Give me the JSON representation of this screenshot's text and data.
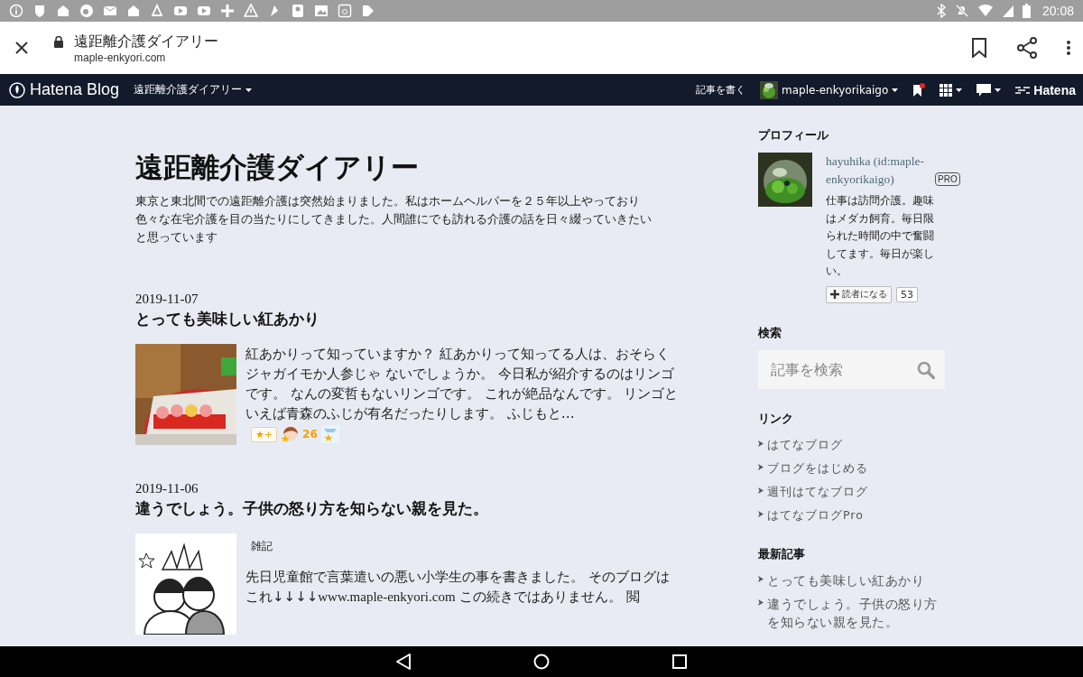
{
  "status_bar": {
    "time": "20:08"
  },
  "browser": {
    "title": "遠距離介護ダイアリー",
    "url": "maple-enkyori.com"
  },
  "hatena_bar": {
    "logo": "Hatena Blog",
    "blog_menu": "遠距離介護ダイアリー",
    "write": "記事を書く",
    "user": "maple-enkyorikaigo",
    "brand": "Hatena"
  },
  "blog": {
    "title": "遠距離介護ダイアリー",
    "description": "東京と東北間での遠距離介護は突然始まりました。私はホームヘルパーを２５年以上やっており色々な在宅介護を目の当たりにしてきました。人間誰にでも訪れる介護の話を日々綴っていきたいと思っています"
  },
  "posts": [
    {
      "date": "2019-11-07",
      "title": "とっても美味しい紅あかり",
      "excerpt": "紅あかりって知っていますか？ 紅あかりって知ってる人は、おそらくジャガイモか人参じゃ ないでしょうか。 今日私が紹介するのはリンゴです。 なんの変哲もないリンゴです。 これが絶品なんです。 リンゴといえば青森のふじが有名だったりします。 ふじもと…",
      "stars": {
        "add": "★+",
        "count": "26"
      }
    },
    {
      "date": "2019-11-06",
      "title": "違うでしょう。子供の怒り方を知らない親を見た。",
      "category": "雑記",
      "excerpt": "先日児童館で言葉遣いの悪い小学生の事を書きました。 そのブログはこれ↓↓↓↓",
      "link": "www.maple-enkyori.com",
      "excerpt_after": " この続きではありません。 閲"
    }
  ],
  "sidebar": {
    "profile": {
      "heading": "プロフィール",
      "name": "hayuhika (id:maple-enkyorikaigo)",
      "badge": "PRO",
      "bio": "仕事は訪問介護。趣味はメダカ飼育。毎日限られた時間の中で奮闘してます。毎日が楽しい。",
      "subscribe": "読者になる",
      "subscribers": "53"
    },
    "search": {
      "heading": "検索",
      "placeholder": "記事を検索"
    },
    "links": {
      "heading": "リンク",
      "items": [
        "はてなブログ",
        "ブログをはじめる",
        "週刊はてなブログ",
        "はてなブログPro"
      ]
    },
    "recent": {
      "heading": "最新記事",
      "items": [
        "とっても美味しい紅あかり",
        "違うでしょう。子供の怒り方を知らない親を見た。"
      ]
    }
  }
}
